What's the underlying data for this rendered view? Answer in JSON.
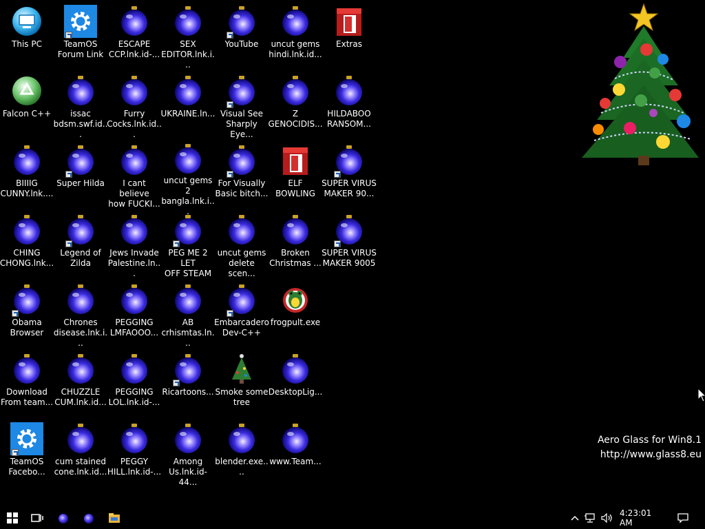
{
  "desktop": {
    "icons": [
      {
        "label": "This PC",
        "kind": "pc",
        "shortcut": false
      },
      {
        "label": "Falcon C++",
        "kind": "recycle",
        "shortcut": false
      },
      {
        "label": "BIIIIG\nCUNNY.lnk....",
        "kind": "ornament",
        "shortcut": false
      },
      {
        "label": "CHING\nCHONG.lnk...",
        "kind": "ornament",
        "shortcut": false
      },
      {
        "label": "Obama\nBrowser",
        "kind": "ornament",
        "shortcut": true
      },
      {
        "label": "Download\nFrom team...",
        "kind": "ornament",
        "shortcut": false
      },
      {
        "label": "TeamOS\nFacebo...",
        "kind": "gear",
        "shortcut": true
      },
      {
        "label": "TeamOS\nForum Link",
        "kind": "gear",
        "shortcut": true
      },
      {
        "label": "issac\nbdsm.swf.id...",
        "kind": "ornament",
        "shortcut": false
      },
      {
        "label": "Super Hilda",
        "kind": "ornament",
        "shortcut": true
      },
      {
        "label": "Legend of\nZilda",
        "kind": "ornament",
        "shortcut": true
      },
      {
        "label": "Chrones\ndisease.lnk.i...",
        "kind": "ornament",
        "shortcut": false
      },
      {
        "label": "CHUZZLE\nCUM.lnk.id...",
        "kind": "ornament",
        "shortcut": false
      },
      {
        "label": "cum stained\ncone.lnk.id...",
        "kind": "ornament",
        "shortcut": false
      },
      {
        "label": "ESCAPE\nCCP.lnk.id-...",
        "kind": "ornament",
        "shortcut": false
      },
      {
        "label": "Furry\nCocks.lnk.id...",
        "kind": "ornament",
        "shortcut": false
      },
      {
        "label": "I cant believe\nhow FUCKI...",
        "kind": "ornament",
        "shortcut": false
      },
      {
        "label": "Jews Invade\nPalestine.ln...",
        "kind": "ornament",
        "shortcut": false
      },
      {
        "label": "PEGGING\nLMFAOOO...",
        "kind": "ornament",
        "shortcut": false
      },
      {
        "label": "PEGGING\nLOL.lnk.id-...",
        "kind": "ornament",
        "shortcut": false
      },
      {
        "label": "PEGGY\nHILL.lnk.id-...",
        "kind": "ornament",
        "shortcut": false
      },
      {
        "label": "SEX\nEDITOR.lnk.i...",
        "kind": "ornament",
        "shortcut": false
      },
      {
        "label": "UKRAINE.ln...",
        "kind": "ornament",
        "shortcut": false
      },
      {
        "label": "uncut gems 2\nbangla.lnk.i...",
        "kind": "ornament",
        "shortcut": false
      },
      {
        "label": "PEG ME 2 LET\nOFF STEAM",
        "kind": "ornament",
        "shortcut": true
      },
      {
        "label": "AB\ncrhismtas.ln...",
        "kind": "ornament",
        "shortcut": false
      },
      {
        "label": "Ricartoons...",
        "kind": "ornament",
        "shortcut": true
      },
      {
        "label": "Among\nUs.lnk.id-44...",
        "kind": "ornament",
        "shortcut": false
      },
      {
        "label": "YouTube",
        "kind": "ornament",
        "shortcut": true
      },
      {
        "label": "Visual See\nSharply Eye...",
        "kind": "ornament",
        "shortcut": true
      },
      {
        "label": "For Visually\nBasic bitch...",
        "kind": "ornament",
        "shortcut": true
      },
      {
        "label": "uncut gems\ndelete scen...",
        "kind": "ornament",
        "shortcut": false
      },
      {
        "label": "Embarcadero\nDev-C++",
        "kind": "ornament",
        "shortcut": true
      },
      {
        "label": "Smoke some\ntree",
        "kind": "tree",
        "shortcut": false
      },
      {
        "label": "blender.exe....",
        "kind": "ornament",
        "shortcut": false
      },
      {
        "label": "uncut gems\nhindi.lnk.id...",
        "kind": "ornament",
        "shortcut": false
      },
      {
        "label": "Z\nGENOCIDIS...",
        "kind": "ornament",
        "shortcut": false
      },
      {
        "label": "ELF BOWLING",
        "kind": "box",
        "shortcut": false
      },
      {
        "label": "Broken\nChristmas ...",
        "kind": "ornament",
        "shortcut": false
      },
      {
        "label": "frogpult.exe",
        "kind": "frog",
        "shortcut": false
      },
      {
        "label": "DesktopLig...",
        "kind": "ornament",
        "shortcut": false
      },
      {
        "label": "www.Team...",
        "kind": "ornament",
        "shortcut": false
      },
      {
        "label": "Extras",
        "kind": "box",
        "shortcut": false
      },
      {
        "label": "HILDABOO\nRANSOM...",
        "kind": "ornament",
        "shortcut": false
      },
      {
        "label": "SUPER VIRUS\nMAKER 90...",
        "kind": "ornament",
        "shortcut": true
      },
      {
        "label": "SUPER VIRUS\nMAKER 9005",
        "kind": "ornament",
        "shortcut": true
      }
    ]
  },
  "watermark": {
    "line1": "Aero Glass for Win8.1",
    "line2": "http://www.glass8.eu"
  },
  "taskbar": {
    "start_icon": "windows-start-icon",
    "task_view_icon": "task-view-icon",
    "clock": "4:23:01 AM",
    "tray_icons": [
      "chevron-up-icon",
      "network-icon",
      "volume-icon",
      "notifications-icon"
    ]
  },
  "colors": {
    "desktop_bg": "#000000",
    "ornament": "#3a2be0",
    "gear_tile": "#1e88e5"
  }
}
